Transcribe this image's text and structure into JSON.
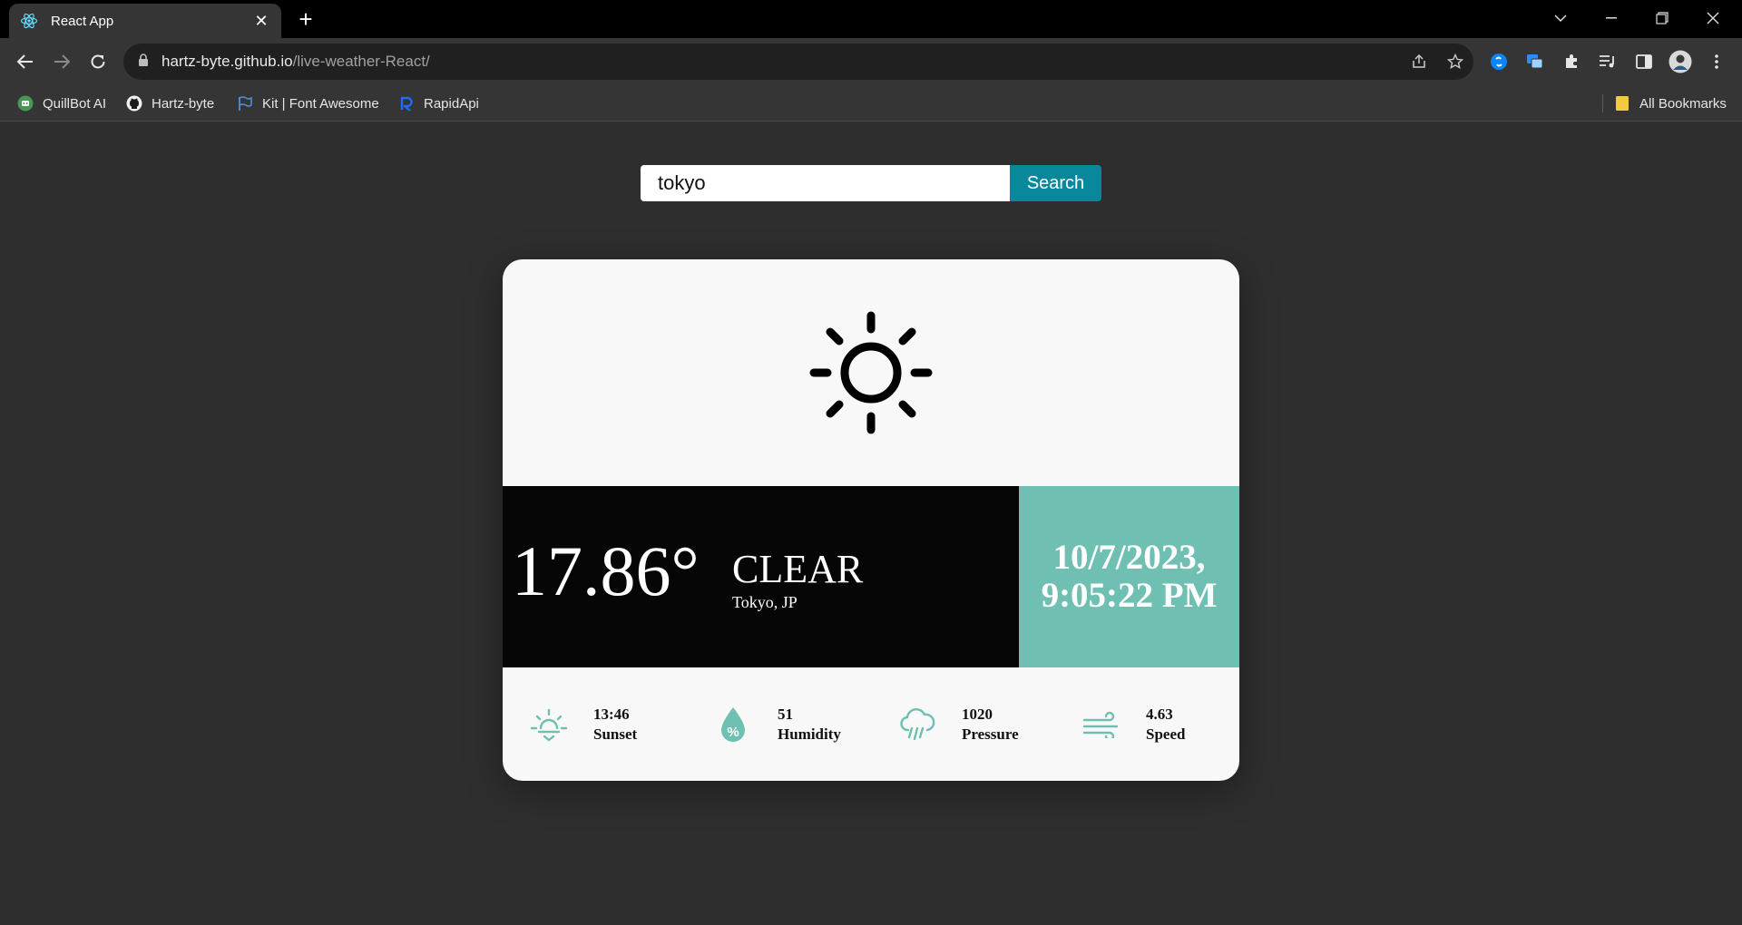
{
  "browser": {
    "tab_title": "React App",
    "url_host": "hartz-byte.github.io",
    "url_path": "/live-weather-React/",
    "bookmarks": [
      {
        "label": "QuillBot AI",
        "icon": "quillbot-icon"
      },
      {
        "label": "Hartz-byte",
        "icon": "github-icon"
      },
      {
        "label": "Kit | Font Awesome",
        "icon": "flag-icon"
      },
      {
        "label": "RapidApi",
        "icon": "rapidapi-icon"
      }
    ],
    "all_bookmarks_label": "All Bookmarks"
  },
  "search": {
    "value": "tokyo",
    "button_label": "Search"
  },
  "weather": {
    "icon": "sun-icon",
    "temperature": "17.86°",
    "condition": "CLEAR",
    "location": "Tokyo, JP",
    "date": "10/7/2023,",
    "time": "9:05:22 PM"
  },
  "stats": [
    {
      "icon": "sunset-icon",
      "value": "13:46",
      "label": "Sunset"
    },
    {
      "icon": "humidity-icon",
      "value": "51",
      "label": "Humidity"
    },
    {
      "icon": "pressure-icon",
      "value": "1020",
      "label": "Pressure"
    },
    {
      "icon": "wind-icon",
      "value": "4.63",
      "label": "Speed"
    }
  ],
  "colors": {
    "accent": "#6fbfb2",
    "search_button": "#09889b",
    "temp_panel": "#060606"
  }
}
